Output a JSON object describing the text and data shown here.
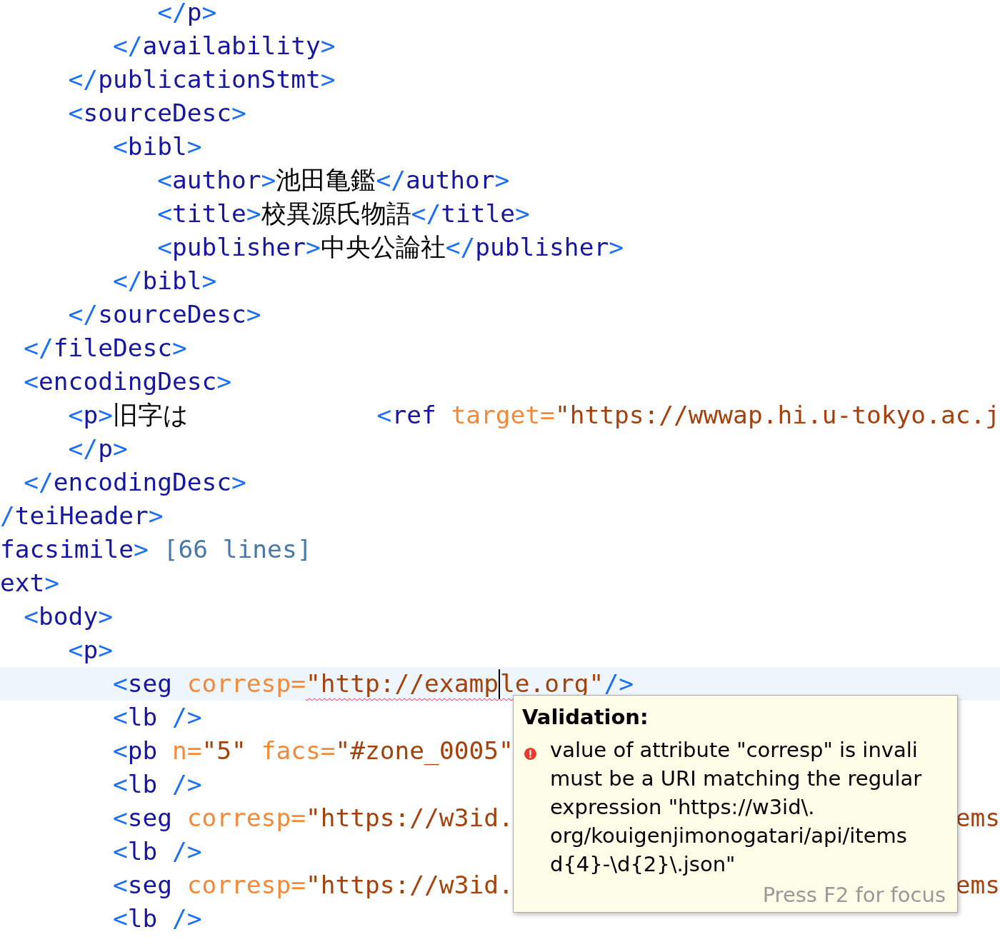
{
  "editor": {
    "lines": [
      {
        "children": [
          {
            "children": [
              {
                "children": [
                  {
                    "children": [
                      {
                        "current": false,
                        "parts": [
                          {
                            "kind": "code",
                            "tokens": [
                              {
                                "kind": "punct",
                                "t": "</"
                              },
                              {
                                "kind": "tag",
                                "t": "p"
                              },
                              {
                                "kind": "punct",
                                "t": ">"
                              }
                            ]
                          }
                        ]
                      }
                    ]
                  },
                  {
                    "current": false,
                    "parts": [
                      {
                        "kind": "code",
                        "tokens": [
                          {
                            "kind": "punct",
                            "t": "</"
                          },
                          {
                            "kind": "tag",
                            "t": "availability"
                          },
                          {
                            "kind": "punct",
                            "t": ">"
                          }
                        ]
                      }
                    ]
                  }
                ]
              },
              {
                "current": false,
                "parts": [
                  {
                    "kind": "code",
                    "tokens": [
                      {
                        "kind": "punct",
                        "t": "</"
                      },
                      {
                        "kind": "tag",
                        "t": "publicationStmt"
                      },
                      {
                        "kind": "punct",
                        "t": ">"
                      }
                    ]
                  }
                ]
              },
              {
                "current": false,
                "parts": [
                  {
                    "kind": "code",
                    "tokens": [
                      {
                        "kind": "punct",
                        "t": "<"
                      },
                      {
                        "kind": "tag",
                        "t": "sourceDesc"
                      },
                      {
                        "kind": "punct",
                        "t": ">"
                      }
                    ]
                  }
                ],
                "children": [
                  {
                    "current": false,
                    "parts": [
                      {
                        "kind": "code",
                        "tokens": [
                          {
                            "kind": "punct",
                            "t": "<"
                          },
                          {
                            "kind": "tag",
                            "t": "bibl"
                          },
                          {
                            "kind": "punct",
                            "t": ">"
                          }
                        ]
                      }
                    ],
                    "children": [
                      {
                        "current": false,
                        "parts": [
                          {
                            "kind": "code",
                            "tokens": [
                              {
                                "kind": "punct",
                                "t": "<"
                              },
                              {
                                "kind": "tag",
                                "t": "author"
                              },
                              {
                                "kind": "punct",
                                "t": ">"
                              },
                              {
                                "kind": "text",
                                "t": "池田亀鑑"
                              },
                              {
                                "kind": "punct",
                                "t": "</"
                              },
                              {
                                "kind": "tag",
                                "t": "author"
                              },
                              {
                                "kind": "punct",
                                "t": ">"
                              }
                            ]
                          }
                        ]
                      },
                      {
                        "current": false,
                        "parts": [
                          {
                            "kind": "code",
                            "tokens": [
                              {
                                "kind": "punct",
                                "t": "<"
                              },
                              {
                                "kind": "tag",
                                "t": "title"
                              },
                              {
                                "kind": "punct",
                                "t": ">"
                              },
                              {
                                "kind": "text",
                                "t": "校異源氏物語"
                              },
                              {
                                "kind": "punct",
                                "t": "</"
                              },
                              {
                                "kind": "tag",
                                "t": "title"
                              },
                              {
                                "kind": "punct",
                                "t": ">"
                              }
                            ]
                          }
                        ]
                      },
                      {
                        "current": false,
                        "parts": [
                          {
                            "kind": "code",
                            "tokens": [
                              {
                                "kind": "punct",
                                "t": "<"
                              },
                              {
                                "kind": "tag",
                                "t": "publisher"
                              },
                              {
                                "kind": "punct",
                                "t": ">"
                              },
                              {
                                "kind": "text",
                                "t": "中央公論社"
                              },
                              {
                                "kind": "punct",
                                "t": "</"
                              },
                              {
                                "kind": "tag",
                                "t": "publisher"
                              },
                              {
                                "kind": "punct",
                                "t": ">"
                              }
                            ]
                          }
                        ]
                      }
                    ]
                  },
                  {
                    "current": false,
                    "parts": [
                      {
                        "kind": "code",
                        "tokens": [
                          {
                            "kind": "punct",
                            "t": "</"
                          },
                          {
                            "kind": "tag",
                            "t": "bibl"
                          },
                          {
                            "kind": "punct",
                            "t": ">"
                          }
                        ]
                      }
                    ]
                  }
                ]
              },
              {
                "current": false,
                "parts": [
                  {
                    "kind": "code",
                    "tokens": [
                      {
                        "kind": "punct",
                        "t": "</"
                      },
                      {
                        "kind": "tag",
                        "t": "sourceDesc"
                      },
                      {
                        "kind": "punct",
                        "t": ">"
                      }
                    ]
                  }
                ]
              }
            ]
          },
          {
            "current": false,
            "parts": [
              {
                "kind": "code",
                "tokens": [
                  {
                    "kind": "punct",
                    "t": "</"
                  },
                  {
                    "kind": "tag",
                    "t": "fileDesc"
                  },
                  {
                    "kind": "punct",
                    "t": ">"
                  }
                ]
              }
            ]
          },
          {
            "current": false,
            "parts": [
              {
                "kind": "code",
                "tokens": [
                  {
                    "kind": "punct",
                    "t": "<"
                  },
                  {
                    "kind": "tag",
                    "t": "encodingDesc"
                  },
                  {
                    "kind": "punct",
                    "t": ">"
                  }
                ]
              }
            ],
            "children": [
              {
                "current": false,
                "parts": [
                  {
                    "kind": "code",
                    "tokens": [
                      {
                        "kind": "punct",
                        "t": "<"
                      },
                      {
                        "kind": "tag",
                        "t": "p"
                      },
                      {
                        "kind": "punct",
                        "t": ">"
                      },
                      {
                        "kind": "text",
                        "t": "旧字は"
                      }
                    ]
                  },
                  {
                    "kind": "gap"
                  },
                  {
                    "kind": "code",
                    "tokens": [
                      {
                        "kind": "punct",
                        "t": "<"
                      },
                      {
                        "kind": "tag",
                        "t": "ref "
                      },
                      {
                        "kind": "attr",
                        "t": "target="
                      },
                      {
                        "kind": "value",
                        "t": "\"https://wwwap.hi.u-tokyo.ac.j"
                      }
                    ]
                  }
                ]
              },
              {
                "current": false,
                "parts": [
                  {
                    "kind": "code",
                    "tokens": [
                      {
                        "kind": "punct",
                        "t": "</"
                      },
                      {
                        "kind": "tag",
                        "t": "p"
                      },
                      {
                        "kind": "punct",
                        "t": ">"
                      }
                    ]
                  }
                ]
              }
            ]
          },
          {
            "current": false,
            "parts": [
              {
                "kind": "code",
                "tokens": [
                  {
                    "kind": "punct",
                    "t": "</"
                  },
                  {
                    "kind": "tag",
                    "t": "encodingDesc"
                  },
                  {
                    "kind": "punct",
                    "t": ">"
                  }
                ]
              }
            ]
          }
        ]
      },
      {
        "current": false,
        "parts": [
          {
            "kind": "code",
            "tokens": [
              {
                "kind": "punct",
                "t": "/"
              },
              {
                "kind": "tag",
                "t": "teiHeader"
              },
              {
                "kind": "punct",
                "t": ">"
              }
            ]
          }
        ]
      },
      {
        "current": false,
        "parts": [
          {
            "kind": "code",
            "tokens": [
              {
                "kind": "tag",
                "t": "facsimile"
              },
              {
                "kind": "punct",
                "t": ">"
              }
            ]
          },
          {
            "kind": "fold",
            "text": "[66 lines]"
          }
        ]
      },
      {
        "current": false,
        "parts": [
          {
            "kind": "code",
            "tokens": [
              {
                "kind": "tag",
                "t": "ext"
              },
              {
                "kind": "punct",
                "t": ">"
              }
            ]
          }
        ],
        "children": [
          {
            "current": false,
            "parts": [
              {
                "kind": "code",
                "tokens": [
                  {
                    "kind": "punct",
                    "t": "<"
                  },
                  {
                    "kind": "tag",
                    "t": "body"
                  },
                  {
                    "kind": "punct",
                    "t": ">"
                  }
                ]
              }
            ],
            "children": [
              {
                "current": false,
                "parts": [
                  {
                    "kind": "code",
                    "tokens": [
                      {
                        "kind": "punct",
                        "t": "<"
                      },
                      {
                        "kind": "tag",
                        "t": "p"
                      },
                      {
                        "kind": "punct",
                        "t": ">"
                      }
                    ]
                  }
                ],
                "children": [
                  {
                    "current": true,
                    "parts": [
                      {
                        "kind": "code",
                        "tokens": [
                          {
                            "kind": "punct",
                            "t": "<"
                          },
                          {
                            "kind": "tag",
                            "t": "seg "
                          },
                          {
                            "kind": "attr",
                            "t": "corresp="
                          },
                          {
                            "kind": "value",
                            "t": "\"http://examp",
                            "error": true
                          }
                        ]
                      },
                      {
                        "kind": "cursor"
                      },
                      {
                        "kind": "code",
                        "tokens": [
                          {
                            "kind": "value",
                            "t": "le.org\"",
                            "error": true
                          },
                          {
                            "kind": "punct",
                            "t": "/>"
                          }
                        ]
                      }
                    ]
                  },
                  {
                    "current": false,
                    "parts": [
                      {
                        "kind": "code",
                        "tokens": [
                          {
                            "kind": "punct",
                            "t": "<"
                          },
                          {
                            "kind": "tag",
                            "t": "lb "
                          },
                          {
                            "kind": "punct",
                            "t": "/>"
                          }
                        ]
                      }
                    ]
                  },
                  {
                    "current": false,
                    "parts": [
                      {
                        "kind": "code",
                        "tokens": [
                          {
                            "kind": "punct",
                            "t": "<"
                          },
                          {
                            "kind": "tag",
                            "t": "pb "
                          },
                          {
                            "kind": "attr",
                            "t": "n="
                          },
                          {
                            "kind": "value",
                            "t": "\"5\" "
                          },
                          {
                            "kind": "attr",
                            "t": "facs="
                          },
                          {
                            "kind": "value",
                            "t": "\"#zone_0005\""
                          }
                        ]
                      }
                    ]
                  },
                  {
                    "current": false,
                    "parts": [
                      {
                        "kind": "code",
                        "tokens": [
                          {
                            "kind": "punct",
                            "t": "<"
                          },
                          {
                            "kind": "tag",
                            "t": "lb "
                          },
                          {
                            "kind": "punct",
                            "t": "/>"
                          }
                        ]
                      }
                    ]
                  },
                  {
                    "current": false,
                    "parts": [
                      {
                        "kind": "code",
                        "tokens": [
                          {
                            "kind": "punct",
                            "t": "<"
                          },
                          {
                            "kind": "tag",
                            "t": "seg "
                          },
                          {
                            "kind": "attr",
                            "t": "corresp="
                          },
                          {
                            "kind": "value",
                            "t": "\"https://w3id."
                          }
                        ]
                      },
                      {
                        "kind": "gap"
                      },
                      {
                        "kind": "code",
                        "tokens": [
                          {
                            "kind": "value",
                            "t": "ems"
                          }
                        ]
                      }
                    ]
                  },
                  {
                    "current": false,
                    "parts": [
                      {
                        "kind": "code",
                        "tokens": [
                          {
                            "kind": "punct",
                            "t": "<"
                          },
                          {
                            "kind": "tag",
                            "t": "lb "
                          },
                          {
                            "kind": "punct",
                            "t": "/>"
                          }
                        ]
                      }
                    ]
                  },
                  {
                    "current": false,
                    "parts": [
                      {
                        "kind": "code",
                        "tokens": [
                          {
                            "kind": "punct",
                            "t": "<"
                          },
                          {
                            "kind": "tag",
                            "t": "seg "
                          },
                          {
                            "kind": "attr",
                            "t": "corresp="
                          },
                          {
                            "kind": "value",
                            "t": "\"https://w3id."
                          }
                        ]
                      },
                      {
                        "kind": "gap"
                      },
                      {
                        "kind": "code",
                        "tokens": [
                          {
                            "kind": "value",
                            "t": "ems"
                          }
                        ]
                      }
                    ]
                  },
                  {
                    "current": false,
                    "parts": [
                      {
                        "kind": "code",
                        "tokens": [
                          {
                            "kind": "punct",
                            "t": "<"
                          },
                          {
                            "kind": "tag",
                            "t": "lb "
                          },
                          {
                            "kind": "punct",
                            "t": "/>"
                          }
                        ]
                      }
                    ]
                  }
                ]
              }
            ]
          }
        ]
      }
    ]
  },
  "tooltip": {
    "title": "Validation:",
    "kind": "error",
    "message_lines": [
      "value of attribute \"corresp\" is invali",
      "must be a URI matching the regular",
      "expression \"https://w3id\\.",
      "org/kouigenjimonogatari/api/items",
      "d{4}-\\d{2}\\.json\""
    ],
    "hint": "Press F2 for focus"
  }
}
